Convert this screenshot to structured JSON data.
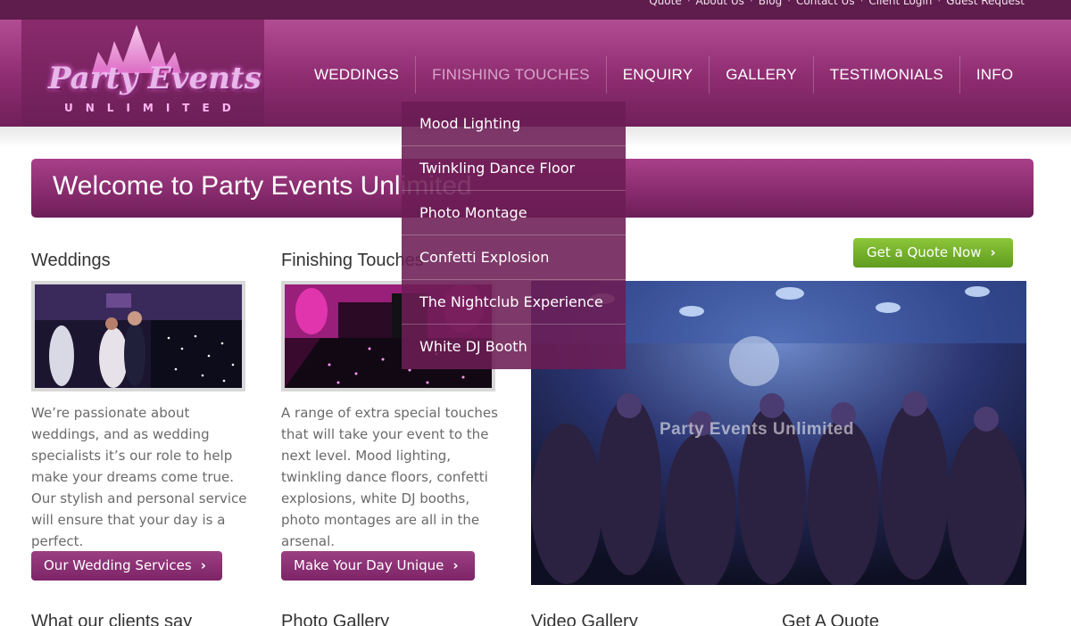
{
  "top_links": [
    "Quote",
    "About Us",
    "Blog",
    "Contact Us",
    "Client Login",
    "Guest Request"
  ],
  "logo": {
    "main": "Party Events",
    "sub": "UNLIMITED"
  },
  "nav": [
    {
      "label": "WEDDINGS"
    },
    {
      "label": "FINISHING TOUCHES"
    },
    {
      "label": "ENQUIRY"
    },
    {
      "label": "GALLERY"
    },
    {
      "label": "TESTIMONIALS"
    },
    {
      "label": "INFO"
    }
  ],
  "dropdown": [
    "Mood Lighting",
    "Twinkling Dance Floor",
    "Photo Montage",
    "Confetti Explosion",
    "The Nightclub Experience",
    "White DJ Booth"
  ],
  "welcome": {
    "title": "Welcome to Party Events Unlimited"
  },
  "columns": {
    "weddings": {
      "title": "Weddings",
      "text": "We’re passionate about weddings, and as wedding specialists it’s our role to help make your dreams come true. Our stylish and personal service will ensure that your day is a perfect.",
      "button": "Our Wedding Services"
    },
    "finishing": {
      "title": "Finishing Touches",
      "text": "A range of extra special touches that will take your event to the next level. Mood lighting, twinkling dance floors, confetti explosions, white DJ booths, photo montages are all in the arsenal.",
      "button": "Make Your Day Unique"
    }
  },
  "quote_button": "Get a Quote Now",
  "hero_watermark": "Party Events Unlimited",
  "bottom_titles": [
    "What our clients say",
    "Photo Gallery",
    "Video Gallery",
    "Get A Quote"
  ],
  "colors": {
    "brand": "#862a6c",
    "accent_green": "#7ab52e",
    "text": "#6a6a6a"
  }
}
